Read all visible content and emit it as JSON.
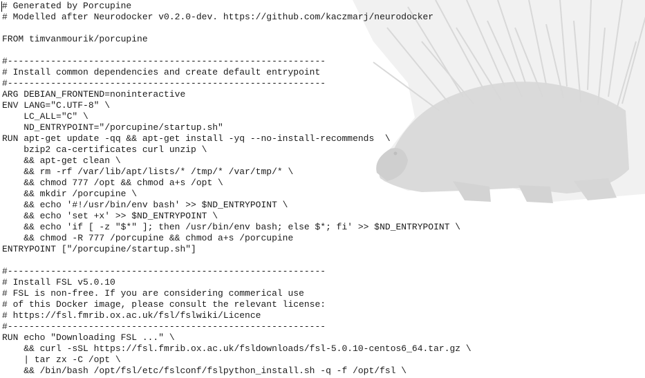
{
  "editor": {
    "lines": [
      "# Generated by Porcupine",
      "# Modelled after Neurodocker v0.2.0-dev. https://github.com/kaczmarj/neurodocker",
      "",
      "FROM timvanmourik/porcupine",
      "",
      "#-----------------------------------------------------------",
      "# Install common dependencies and create default entrypoint",
      "#-----------------------------------------------------------",
      "ARG DEBIAN_FRONTEND=noninteractive",
      "ENV LANG=\"C.UTF-8\" \\",
      "    LC_ALL=\"C\" \\",
      "    ND_ENTRYPOINT=\"/porcupine/startup.sh\"",
      "RUN apt-get update -qq && apt-get install -yq --no-install-recommends  \\",
      "    bzip2 ca-certificates curl unzip \\",
      "    && apt-get clean \\",
      "    && rm -rf /var/lib/apt/lists/* /tmp/* /var/tmp/* \\",
      "    && chmod 777 /opt && chmod a+s /opt \\",
      "    && mkdir /porcupine \\",
      "    && echo '#!/usr/bin/env bash' >> $ND_ENTRYPOINT \\",
      "    && echo 'set +x' >> $ND_ENTRYPOINT \\",
      "    && echo 'if [ -z \"$*\" ]; then /usr/bin/env bash; else $*; fi' >> $ND_ENTRYPOINT \\",
      "    && chmod -R 777 /porcupine && chmod a+s /porcupine",
      "ENTRYPOINT [\"/porcupine/startup.sh\"]",
      "",
      "#-----------------------------------------------------------",
      "# Install FSL v5.0.10",
      "# FSL is non-free. If you are considering commerical use",
      "# of this Docker image, please consult the relevant license:",
      "# https://fsl.fmrib.ox.ac.uk/fsl/fslwiki/Licence",
      "#-----------------------------------------------------------",
      "RUN echo \"Downloading FSL ...\" \\",
      "    && curl -sSL https://fsl.fmrib.ox.ac.uk/fsldownloads/fsl-5.0.10-centos6_64.tar.gz \\",
      "    | tar zx -C /opt \\",
      "    && /bin/bash /opt/fsl/etc/fslconf/fslpython_install.sh -q -f /opt/fsl \\"
    ]
  },
  "background": {
    "image": "porcupine-icon",
    "tint": "#c9c9c9"
  }
}
